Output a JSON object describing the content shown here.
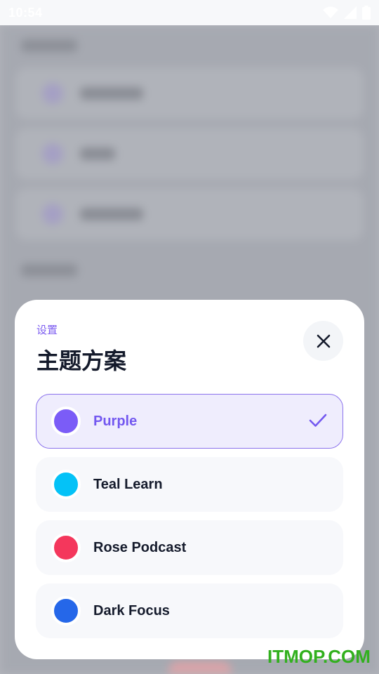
{
  "status_bar": {
    "time": "10:54",
    "icons": [
      "wifi-icon",
      "cellular-signal-icon",
      "battery-icon"
    ]
  },
  "sheet": {
    "eyebrow": "设置",
    "title": "主题方案",
    "close_icon": "close-icon"
  },
  "themes": [
    {
      "label": "Purple",
      "color": "#7b5cf7",
      "selected": true
    },
    {
      "label": "Teal Learn",
      "color": "#04c2f7",
      "selected": false
    },
    {
      "label": "Rose Podcast",
      "color": "#f4375c",
      "selected": false
    },
    {
      "label": "Dark Focus",
      "color": "#2567e9",
      "selected": false
    }
  ],
  "selected_indicator_icon": "check-icon",
  "accent_color": "#7358f0",
  "watermark": "ITMOP.COM"
}
